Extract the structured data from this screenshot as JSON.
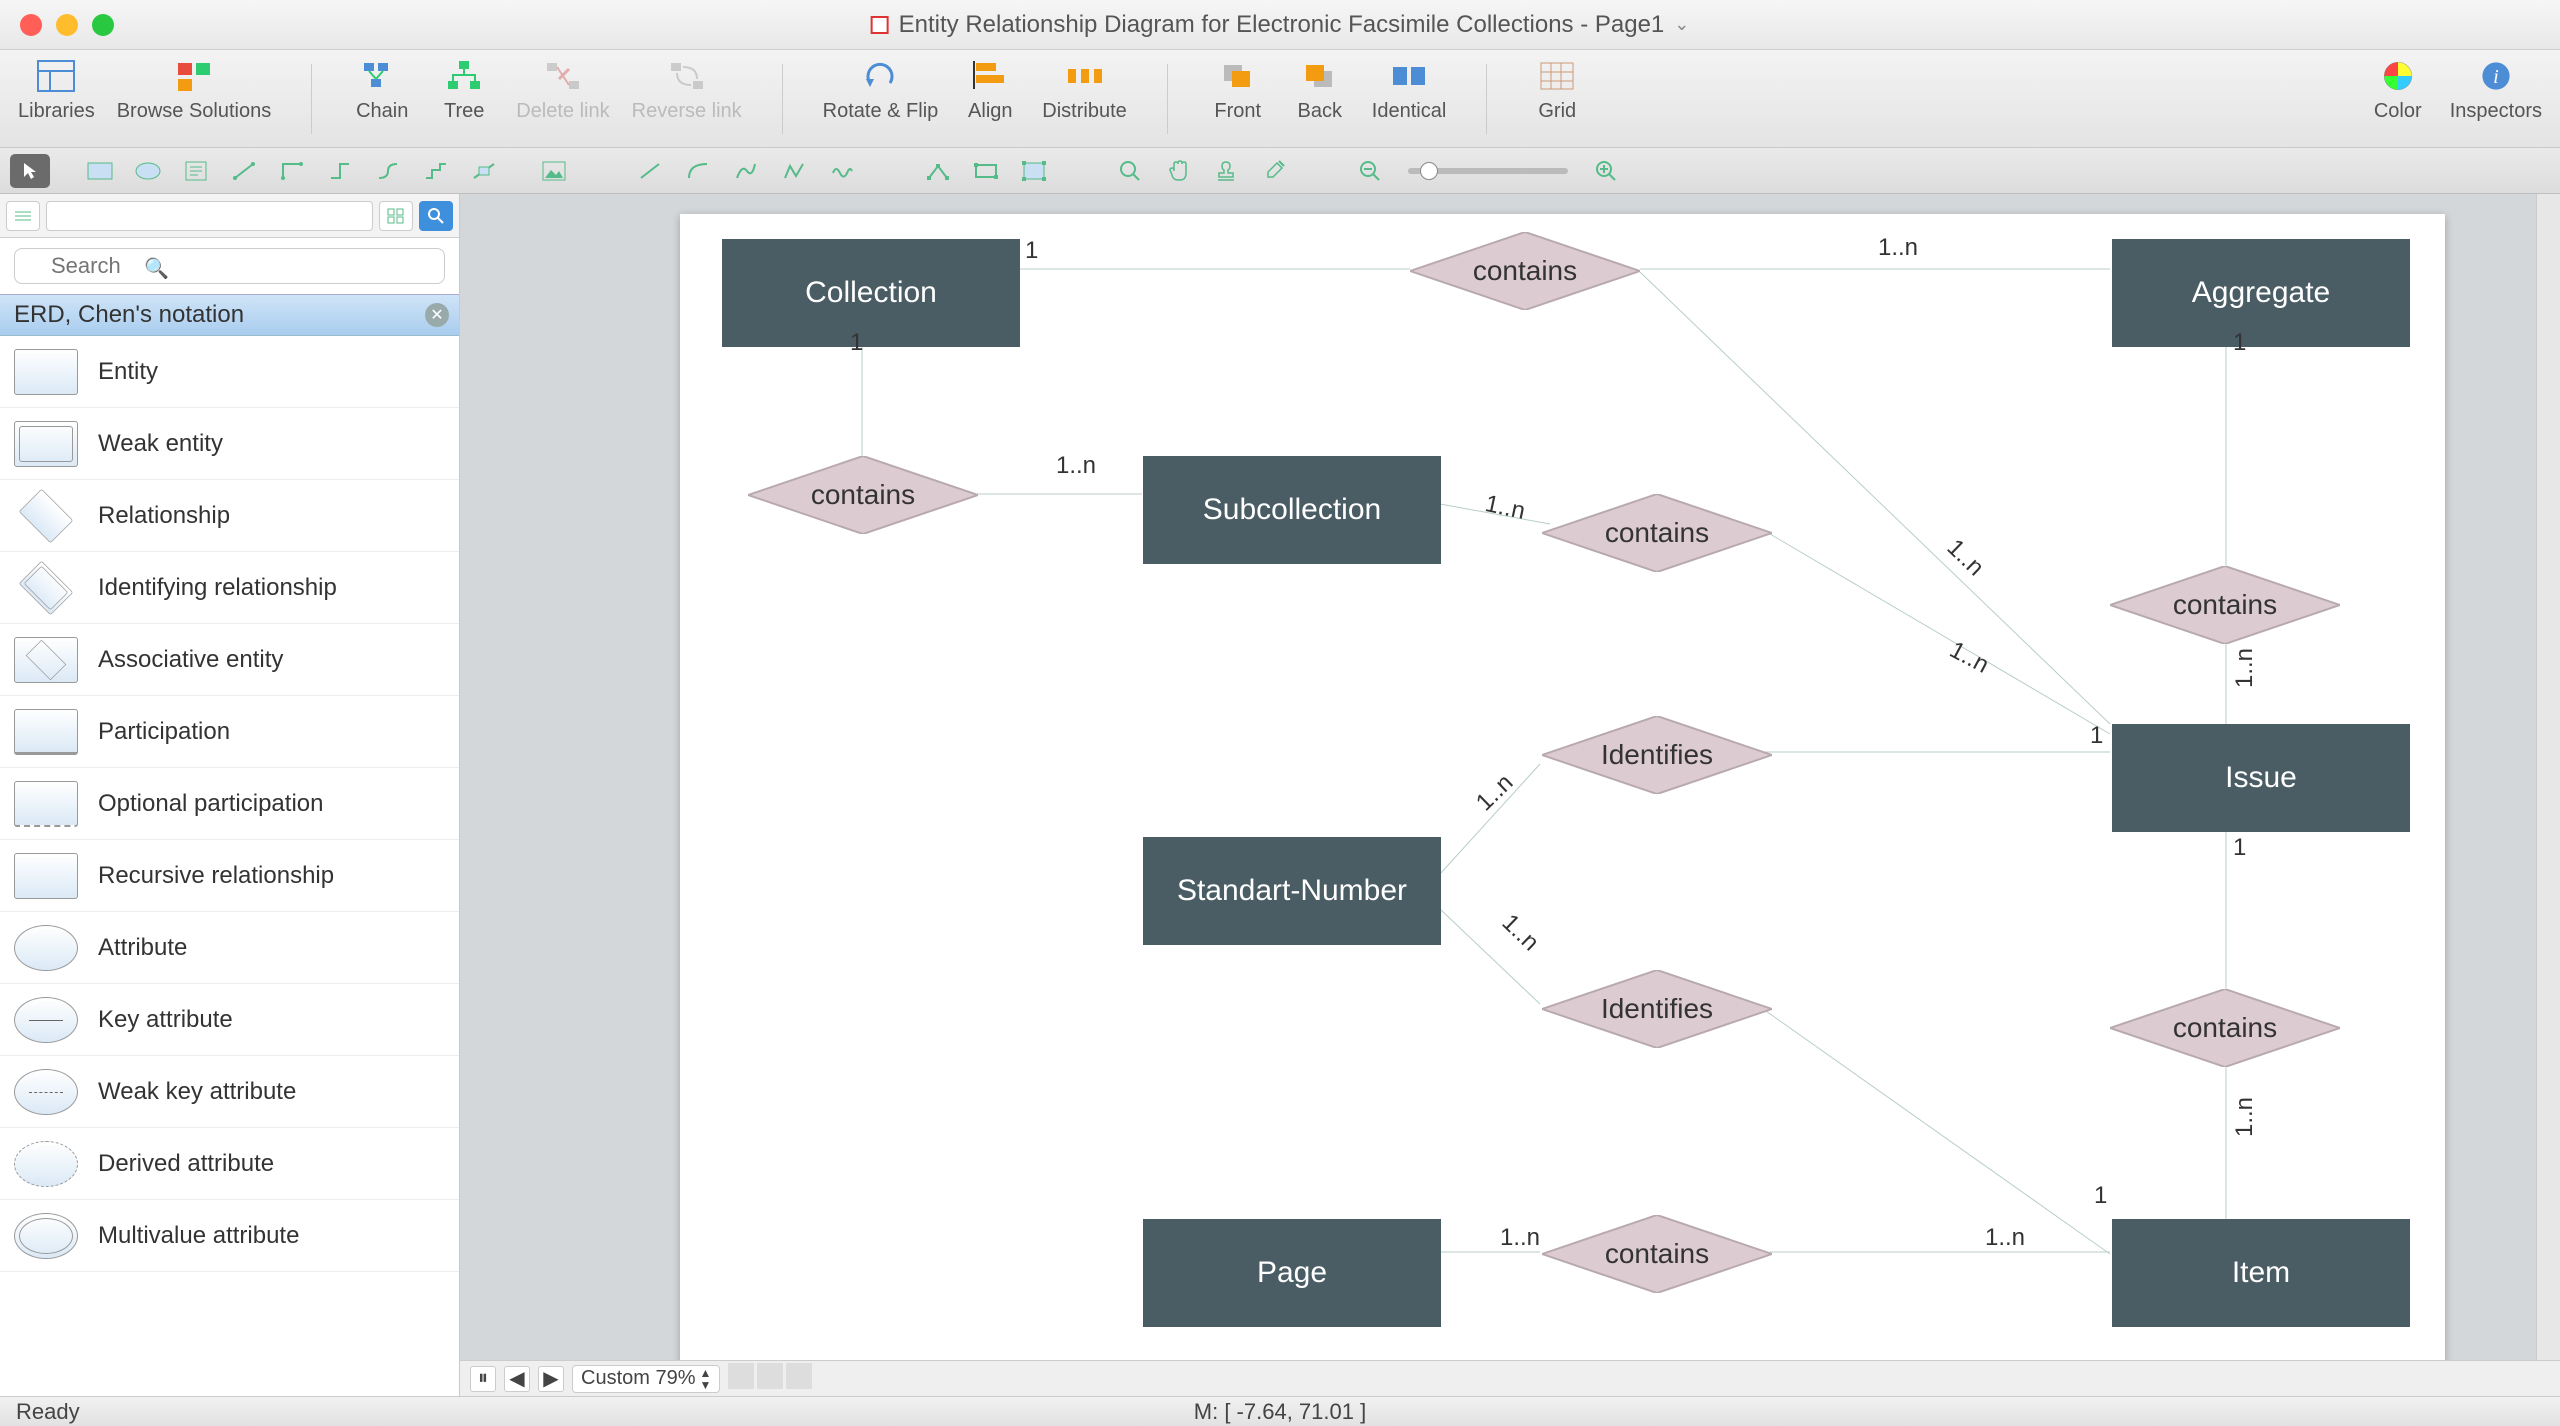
{
  "window": {
    "title": "Entity Relationship Diagram for Electronic Facsimile Collections - Page1"
  },
  "toolbar": {
    "libraries": "Libraries",
    "browse": "Browse Solutions",
    "chain": "Chain",
    "tree": "Tree",
    "delete_link": "Delete link",
    "reverse_link": "Reverse link",
    "rotate": "Rotate & Flip",
    "align": "Align",
    "distribute": "Distribute",
    "front": "Front",
    "back": "Back",
    "identical": "Identical",
    "grid": "Grid",
    "color": "Color",
    "inspectors": "Inspectors"
  },
  "left_panel": {
    "search_placeholder": "Search",
    "category": "ERD, Chen's notation",
    "items": [
      "Entity",
      "Weak entity",
      "Relationship",
      "Identifying relationship",
      "Associative entity",
      "Participation",
      "Optional participation",
      "Recursive relationship",
      "Attribute",
      "Key attribute",
      "Weak key attribute",
      "Derived attribute",
      "Multivalue attribute"
    ]
  },
  "diagram": {
    "entities": {
      "collection": "Collection",
      "aggregate": "Aggregate",
      "subcollection": "Subcollection",
      "issue": "Issue",
      "standart_number": "Standart-Number",
      "page": "Page",
      "item": "Item"
    },
    "relationships": {
      "contains": "contains",
      "identifies": "Identifies"
    },
    "cardinalities": {
      "one": "1",
      "one_n": "1..n"
    }
  },
  "canvas_bar": {
    "zoom_label": "Custom 79%"
  },
  "status": {
    "ready": "Ready",
    "mouse": "M: [ -7.64, 71.01 ]"
  }
}
